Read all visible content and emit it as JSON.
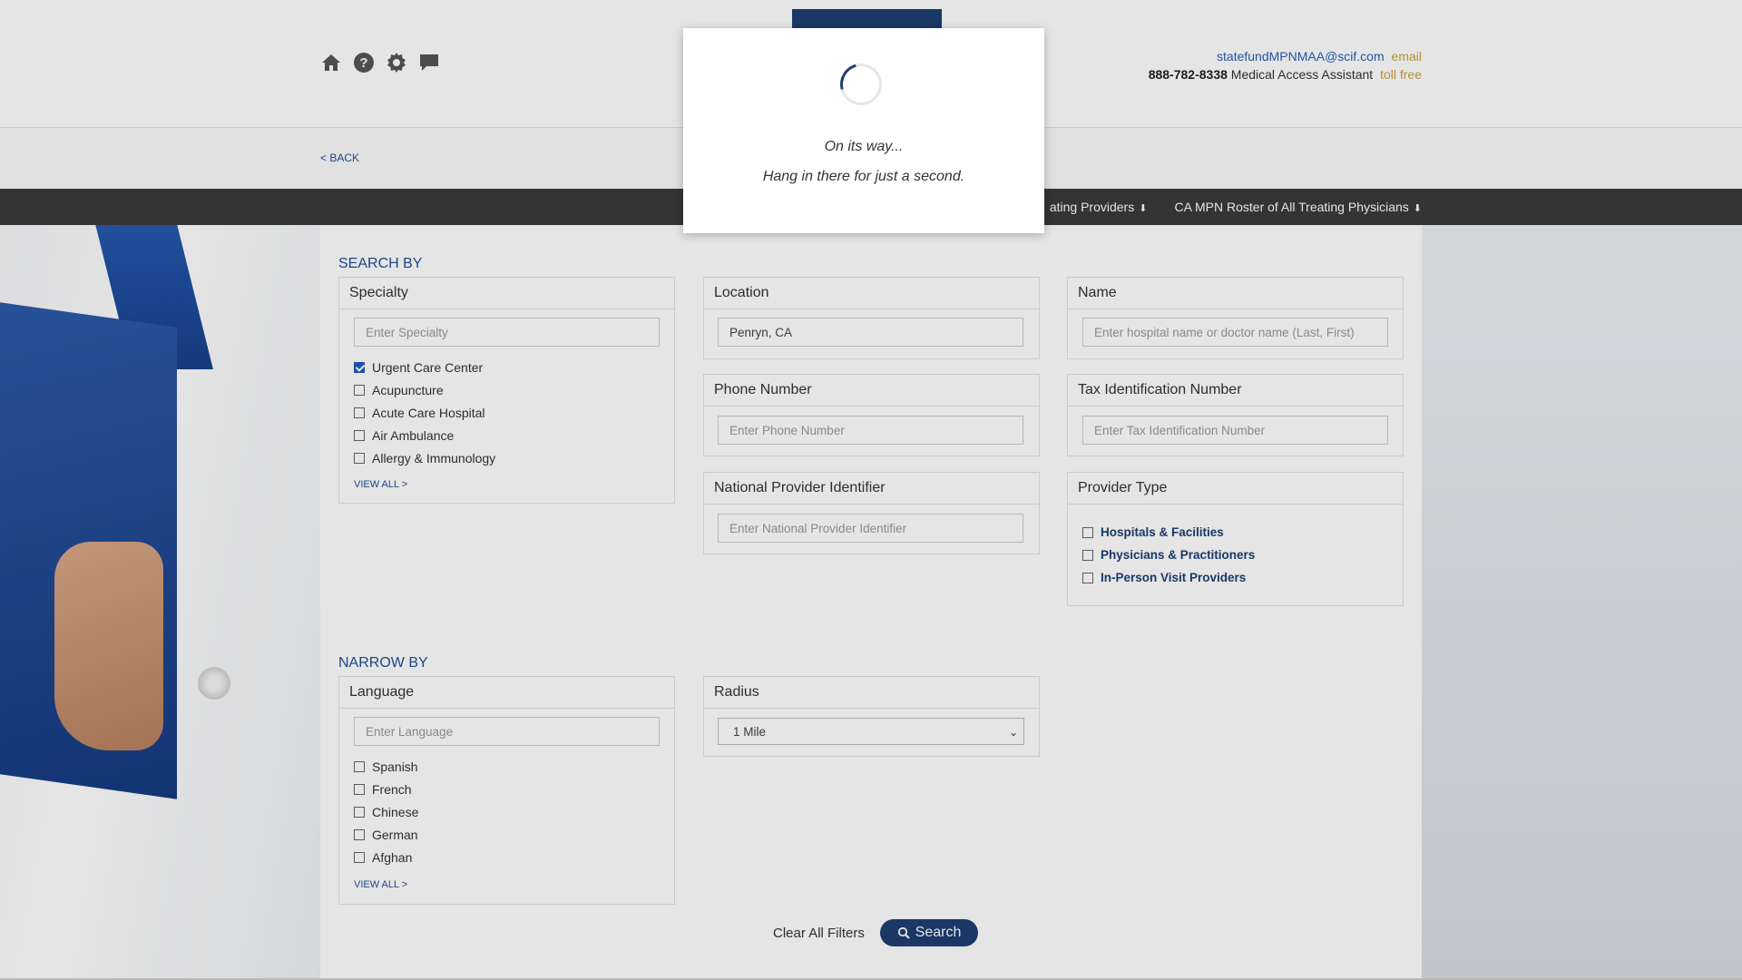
{
  "header": {
    "email": "statefundMPNMAA@scif.com",
    "email_tag": "email",
    "phone": "888-782-8338",
    "phone_desc": "Medical Access Assistant",
    "phone_tag": "toll free"
  },
  "icons": [
    "home-icon",
    "help-icon",
    "settings-icon",
    "chat-icon"
  ],
  "back_label": "< BACK",
  "navbar": {
    "link1": "ating Providers",
    "link2": "CA MPN Roster of All Treating Physicians"
  },
  "search_by": {
    "title": "SEARCH BY",
    "specialty": {
      "label": "Specialty",
      "placeholder": "Enter Specialty",
      "items": [
        {
          "label": "Urgent Care Center",
          "checked": true
        },
        {
          "label": "Acupuncture",
          "checked": false
        },
        {
          "label": "Acute Care Hospital",
          "checked": false
        },
        {
          "label": "Air Ambulance",
          "checked": false
        },
        {
          "label": "Allergy & Immunology",
          "checked": false
        }
      ],
      "view_all": "VIEW ALL >"
    },
    "location": {
      "label": "Location",
      "value": "Penryn, CA"
    },
    "name": {
      "label": "Name",
      "placeholder": "Enter hospital name or doctor name (Last, First)"
    },
    "phone": {
      "label": "Phone Number",
      "placeholder": "Enter Phone Number"
    },
    "tin": {
      "label": "Tax Identification Number",
      "placeholder": "Enter Tax Identification Number"
    },
    "npi": {
      "label": "National Provider Identifier",
      "placeholder": "Enter National Provider Identifier"
    },
    "provider_type": {
      "label": "Provider Type",
      "items": [
        "Hospitals & Facilities",
        "Physicians & Practitioners",
        "In-Person Visit Providers"
      ]
    }
  },
  "narrow_by": {
    "title": "NARROW BY",
    "language": {
      "label": "Language",
      "placeholder": "Enter Language",
      "items": [
        "Spanish",
        "French",
        "Chinese",
        "German",
        "Afghan"
      ],
      "view_all": "VIEW ALL >"
    },
    "radius": {
      "label": "Radius",
      "value": "1 Mile"
    }
  },
  "actions": {
    "clear": "Clear All Filters",
    "search": "Search"
  },
  "modal": {
    "line1": "On its way...",
    "line2": "Hang in there for just a second."
  }
}
